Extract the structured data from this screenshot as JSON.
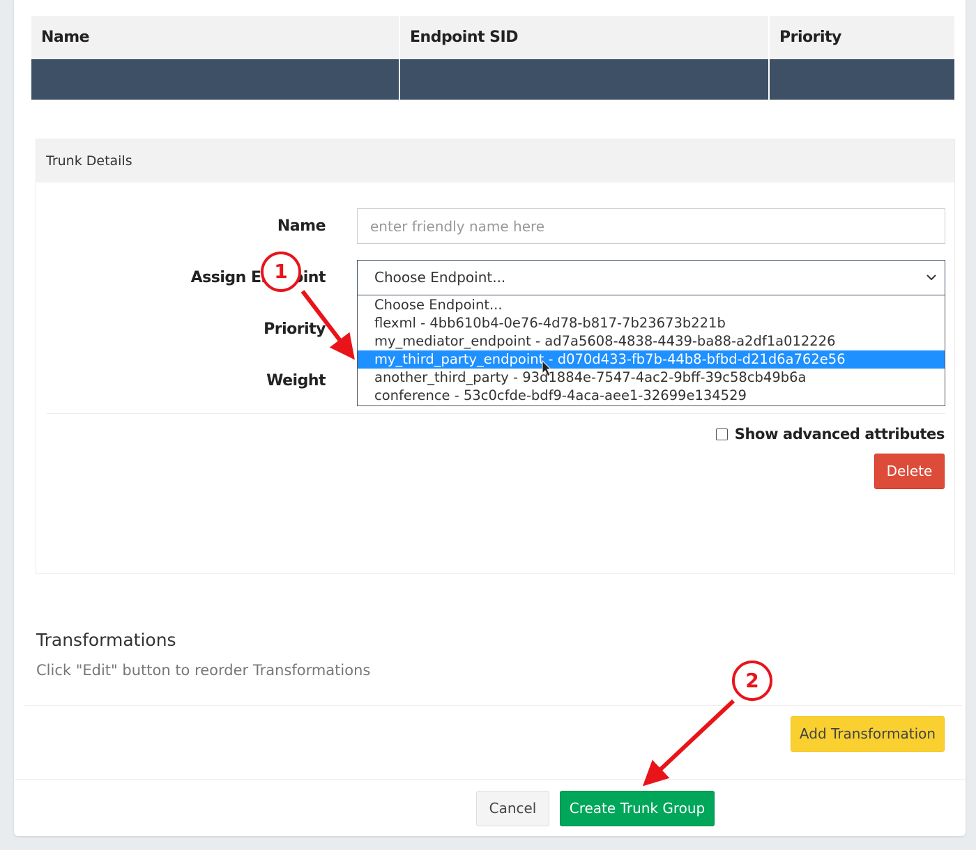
{
  "table": {
    "headers": [
      "Name",
      "Endpoint SID",
      "Priority"
    ]
  },
  "trunk": {
    "panel_title": "Trunk Details",
    "name_label": "Name",
    "name_placeholder": "enter friendly name here",
    "endpoint_label": "Assign Endpoint",
    "priority_label": "Priority",
    "weight_label": "Weight",
    "endpoint_selected": "Choose Endpoint...",
    "endpoint_options": [
      "Choose Endpoint...",
      "flexml - 4bb610b4-0e76-4d78-b817-7b23673b221b",
      "my_mediator_endpoint - ad7a5608-4838-4439-ba88-a2df1a012226",
      "my_third_party_endpoint - d070d433-fb7b-44b8-bfbd-d21d6a762e56",
      "another_third_party - 93d1884e-7547-4ac2-9bff-39c58cb49b6a",
      "conference - 53c0cfde-bdf9-4aca-aee1-32699e134529"
    ],
    "highlighted_option_index": 3,
    "show_advanced_label": "Show advanced attributes",
    "show_advanced_checked": false,
    "delete_label": "Delete"
  },
  "transformations": {
    "title": "Transformations",
    "subtitle": "Click \"Edit\" button to reorder Transformations",
    "add_label": "Add Transformation"
  },
  "footer": {
    "cancel_label": "Cancel",
    "create_label": "Create Trunk Group"
  },
  "annotations": {
    "marker1": "1",
    "marker2": "2"
  },
  "colors": {
    "table_row": "#3e5066",
    "highlight": "#1e90ff",
    "delete": "#dd4b39",
    "add_transformation": "#f9d030",
    "create": "#00a65a",
    "annotation": "#e8141a"
  },
  "icons": {
    "select_chevron": "chevron-down-icon",
    "arrow": "arrow-icon",
    "cursor": "mouse-cursor-icon"
  }
}
